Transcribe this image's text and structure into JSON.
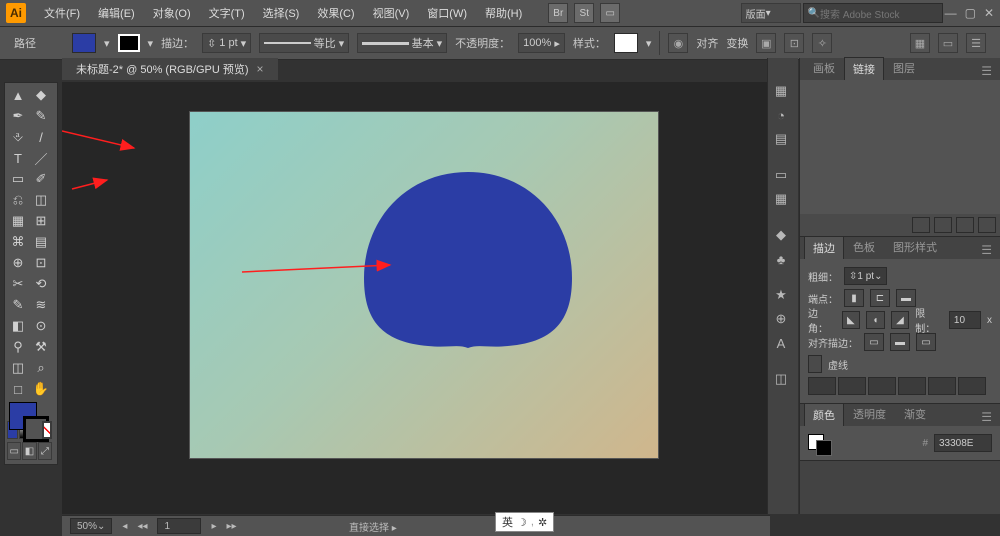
{
  "app": {
    "logo": "Ai"
  },
  "menu": [
    "文件(F)",
    "编辑(E)",
    "对象(O)",
    "文字(T)",
    "选择(S)",
    "效果(C)",
    "视图(V)",
    "窗口(W)",
    "帮助(H)"
  ],
  "toprt": {
    "br": "Br",
    "st": "St",
    "layout": "版面",
    "search": "搜索 Adobe Stock"
  },
  "window": {
    "min": "—",
    "max": "▢",
    "close": "✕"
  },
  "ctrl": {
    "mode": "路径",
    "fillcolor": "#2b3da5",
    "strokecolor": "#000000",
    "strokeLbl": "描边：",
    "strokeVal": "1 pt",
    "styleA": "等比",
    "styleB": "基本",
    "opLbl": "不透明度：",
    "opVal": "100%",
    "presetLbl": "样式：",
    "transformLbl": "对齐",
    "shapeLbl": "变换"
  },
  "tab": {
    "title": "未标题-2* @ 50% (RGB/GPU 预览)",
    "close": "×"
  },
  "tools": [
    "▲",
    "◆",
    "✒",
    "✎",
    "⎀",
    "/",
    "T",
    "／",
    "▭",
    "✐",
    "⎌",
    "◫",
    "▦",
    "⊞",
    "⌘",
    "▤",
    "⊕",
    "⊡",
    "✂",
    "⟲",
    "✎",
    "≋",
    "◧",
    "⊙",
    "⚲",
    "⚒",
    "◫",
    "⌕",
    "□",
    "✋"
  ],
  "rdock": [
    "▦",
    "◔",
    "▤",
    "▭",
    "▦",
    "◆",
    "♣",
    "★",
    "⊕",
    "A",
    "◫"
  ],
  "panelA": {
    "tabs": [
      "画板",
      "链接",
      "图层"
    ],
    "active": 1
  },
  "stroke": {
    "tabs": [
      "描边",
      "色板",
      "图形样式"
    ],
    "active": 0,
    "weightLbl": "粗细：",
    "weightVal": "1 pt",
    "capLbl": "端点：",
    "cornerLbl": "边角：",
    "limitLbl": "限制：",
    "limitVal": "10",
    "limitUnit": "x",
    "alignLbl": "对齐描边：",
    "dashLbl": "虚线"
  },
  "color": {
    "tabs": [
      "颜色",
      "透明度",
      "渐变"
    ],
    "active": 0,
    "hex": "33308E"
  },
  "status": {
    "zoom": "50%",
    "nav": "1",
    "tool": "直接选择"
  },
  "ime": {
    "lang": "英",
    "moon": "☽",
    "gear": "✲"
  }
}
